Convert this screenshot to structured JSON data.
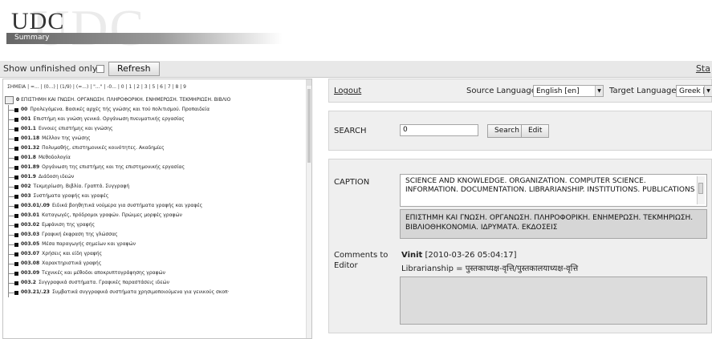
{
  "header": {
    "logo_text": "UDC",
    "logo_ghost": "UDC",
    "logo_subtitle": "Summary"
  },
  "toolbar": {
    "show_unfinished_label": "Show unfinished only",
    "refresh_label": "Refresh",
    "stats_link": "Sta"
  },
  "tree": {
    "alpha_index": [
      "ΣΗΜΕΙΑ",
      "=...",
      "(0...)",
      "(1/9)",
      "(=...)",
      "\"...\"",
      "-0...",
      "0",
      "1",
      "2",
      "3",
      "5",
      "6",
      "7",
      "8",
      "9"
    ],
    "root": {
      "code": "0",
      "text": "ΕΠΙΣΤΗΜΗ ΚΑΙ ΓΝΩΣΗ. ΟΡΓΑΝΩΣΗ. ΠΛΗΡΟΦΟΡΙΚΗ. ΕΝΗΜΕΡΩΣΗ. ΤΕΚΜΗΡΙΩΣΗ. ΒΙΒΛΙΟ"
    },
    "nodes": [
      {
        "code": "00",
        "text": "Προλεγόμενα. Βασικές αρχές τής γνώσης και τού πολιτισμού. Προπαιδεία"
      },
      {
        "code": "001",
        "text": "Επιστήμη και γνώση γενικά. Οργάνωση πνευματικής εργασίας"
      },
      {
        "code": "001.1",
        "text": "Εννοιες επιστήμης και γνώσης"
      },
      {
        "code": "001.18",
        "text": "Μέλλον της γνώσης"
      },
      {
        "code": "001.32",
        "text": "Πολυμαθής, επιστημονικές κοινότητες. Ακαδημίες"
      },
      {
        "code": "001.8",
        "text": "Μεθοδολογία"
      },
      {
        "code": "001.89",
        "text": "Οργάνωση της επιστήμης και της επιστημονικής εργασίας"
      },
      {
        "code": "001.9",
        "text": "Διάδοση ιδεών"
      },
      {
        "code": "002",
        "text": "Τεκμηρίωση. Βιβλία. Γραπτά. Συγγραφή"
      },
      {
        "code": "003",
        "text": "Συστήματα γραφής και γραφές"
      },
      {
        "code": "003.01/.09",
        "text": "Ειδικά βοηθητικά νούμερα για συστήματα γραφής και γραφές"
      },
      {
        "code": "003.01",
        "text": "Καταγωγές, πρόδρομοι γραφών. Πρώιμες μορφές γραφών"
      },
      {
        "code": "003.02",
        "text": "Εμφάνιση της γραφής"
      },
      {
        "code": "003.03",
        "text": "Γραφική έκφραση της γλώσσας"
      },
      {
        "code": "003.05",
        "text": "Μέσα παραγωγής σημείων και γραφών"
      },
      {
        "code": "003.07",
        "text": "Χρήσεις και είδη γραφής"
      },
      {
        "code": "003.08",
        "text": "Χαρακτηριστικά γραφής"
      },
      {
        "code": "003.09",
        "text": "Τεχνικές και μέθοδοι αποκρυπτογράφησης γραφών"
      },
      {
        "code": "003.2",
        "text": "Συγγραφικά συστήματα. Γραφικές παραστάσεις ιδεών"
      },
      {
        "code": "003.21/.23",
        "text": "Συμβατικά συγγραφικά συστήματα χρησιμοποιούμενα για γενικούς σκοπ·"
      }
    ]
  },
  "editor": {
    "logout_label": "Logout",
    "source_language_label": "Source Language",
    "source_language_value": "English [en]",
    "target_language_label": "Target Language",
    "target_language_value": "Greek [el]",
    "search_label": "SEARCH",
    "search_value": "0",
    "search_button": "Search",
    "edit_button": "Edit",
    "caption_label": "CAPTION",
    "caption_source": "SCIENCE AND KNOWLEDGE. ORGANIZATION. COMPUTER SCIENCE. INFORMATION. DOCUMENTATION. LIBRARIANSHIP. INSTITUTIONS. PUBLICATIONS",
    "caption_translation": "ΕΠΙΣΤΗΜΗ ΚΑΙ ΓΝΩΣΗ. ΟΡΓΑΝΩΣΗ. ΠΛΗΡΟΦΟΡΙΚΗ. ΕΝΗΜΕΡΩΣΗ. ΤΕΚΜΗΡΙΩΣΗ. ΒΙΒΛΙΟΘΗΚΟΝΟΜΙΑ. ΙΔΡΥΜΑΤΑ. ΕΚΔΟΣΕΙΣ",
    "comments_label": "Comments to Editor",
    "comment_author": "Vinit",
    "comment_timestamp": "[2010-03-26 05:04:17]",
    "comment_text": "Librarianship = पुस्तकाध्यक्ष-वृत्ति/पुस्तकालयाध्यक्ष-वृत्ति",
    "comment_box_value": ""
  },
  "colors": {
    "panel_bg": "#efefef",
    "translation_bg": "#d6d6d6",
    "comment_box_bg": "#dcdcdc"
  }
}
